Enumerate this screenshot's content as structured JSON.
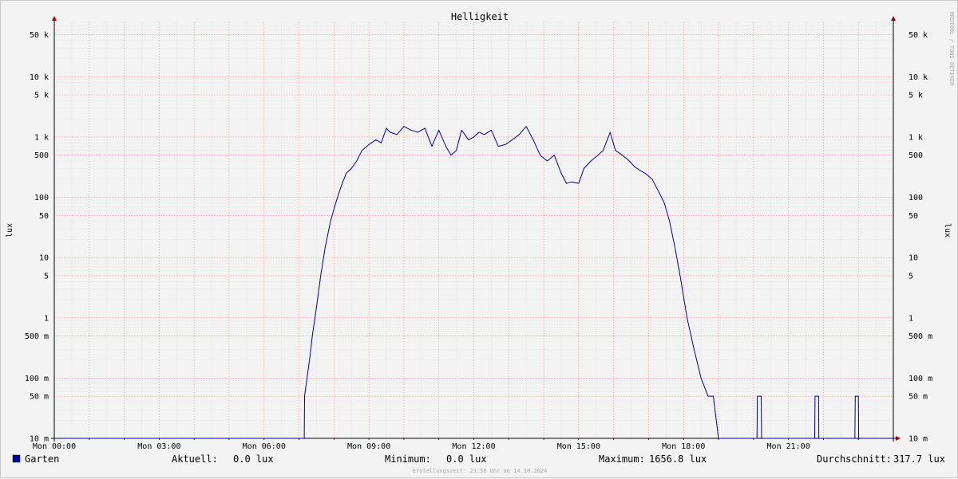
{
  "chart_data": {
    "type": "line",
    "title": "Helligkeit",
    "ylabel_left": "lux",
    "ylabel_right": "lux",
    "y_scale": "log",
    "ylim": [
      0.01,
      80000
    ],
    "xlim_hours": [
      0,
      24
    ],
    "x_tick_labels": [
      "Mon 00:00",
      "Mon 03:00",
      "Mon 06:00",
      "Mon 09:00",
      "Mon 12:00",
      "Mon 15:00",
      "Mon 18:00",
      "Mon 21:00"
    ],
    "y_tick_labels": [
      "50 k",
      "10 k",
      "5 k",
      "1 k",
      "500",
      "100",
      "50",
      "10",
      "5",
      "1",
      "500 m",
      "100 m",
      "50 m",
      "10 m"
    ],
    "y_tick_values": [
      50000,
      10000,
      5000,
      1000,
      500,
      100,
      50,
      10,
      5,
      1,
      0.5,
      0.1,
      0.05,
      0.01
    ],
    "grid": true,
    "line_color": "#000099",
    "series": [
      {
        "name": "Garten",
        "x_hours": [
          0,
          7.15,
          7.16,
          7.3,
          7.38,
          7.5,
          7.62,
          7.75,
          7.9,
          8.05,
          8.2,
          8.35,
          8.5,
          8.65,
          8.8,
          9.0,
          9.2,
          9.35,
          9.5,
          9.6,
          9.8,
          10.0,
          10.2,
          10.4,
          10.6,
          10.8,
          11.0,
          11.2,
          11.35,
          11.5,
          11.65,
          11.85,
          12.0,
          12.15,
          12.3,
          12.5,
          12.7,
          12.9,
          13.1,
          13.3,
          13.5,
          13.7,
          13.9,
          14.1,
          14.3,
          14.5,
          14.65,
          14.8,
          15.0,
          15.15,
          15.35,
          15.55,
          15.7,
          15.9,
          16.05,
          16.25,
          16.45,
          16.6,
          16.75,
          16.9,
          17.1,
          17.3,
          17.45,
          17.6,
          17.75,
          17.9,
          18.1,
          18.3,
          18.5,
          18.7,
          18.85,
          19.0,
          19.1,
          19.2,
          19.3,
          19.4,
          19.5,
          19.55,
          19.6,
          19.8,
          20.0,
          20.1,
          20.11,
          20.22,
          20.23,
          20.5,
          21.0,
          21.5,
          21.75,
          21.76,
          21.86,
          21.87,
          22.2,
          22.6,
          22.9,
          22.91,
          23.0,
          23.01,
          23.5,
          24.0
        ],
        "y_lux": [
          0.01,
          0.01,
          0.05,
          0.2,
          0.5,
          1.5,
          5,
          15,
          40,
          80,
          150,
          250,
          300,
          400,
          600,
          750,
          900,
          800,
          1400,
          1200,
          1100,
          1500,
          1300,
          1200,
          1400,
          700,
          1300,
          700,
          500,
          600,
          1300,
          900,
          1000,
          1200,
          1100,
          1300,
          700,
          750,
          900,
          1100,
          1500,
          900,
          500,
          400,
          500,
          250,
          170,
          180,
          170,
          300,
          400,
          500,
          600,
          1200,
          600,
          500,
          400,
          320,
          280,
          250,
          200,
          120,
          80,
          40,
          15,
          5,
          1,
          0.3,
          0.1,
          0.05,
          0.05,
          0.01,
          0.01,
          0.01,
          0.01,
          0.01,
          0.01,
          0.01,
          0.01,
          0.01,
          0.01,
          0.01,
          0.05,
          0.05,
          0.01,
          0.01,
          0.01,
          0.01,
          0.01,
          0.05,
          0.05,
          0.01,
          0.01,
          0.01,
          0.01,
          0.05,
          0.05,
          0.01,
          0.01,
          0.01
        ]
      }
    ]
  },
  "legend": {
    "series_name": "Garten",
    "swatch_color": "#000099",
    "current_label": "Aktuell:",
    "current_value": "0.0 lux",
    "min_label": "Minimum:",
    "min_value": "0.0 lux",
    "max_label": "Maximum:",
    "max_value": "1656.8 lux",
    "avg_label": "Durchschnitt:",
    "avg_value": "317.7 lux"
  },
  "watermark": "RRDTOOL / TOBI OETIKER",
  "footer": "Erstellungszeit: 23:58 Uhr am 14.10.2024"
}
